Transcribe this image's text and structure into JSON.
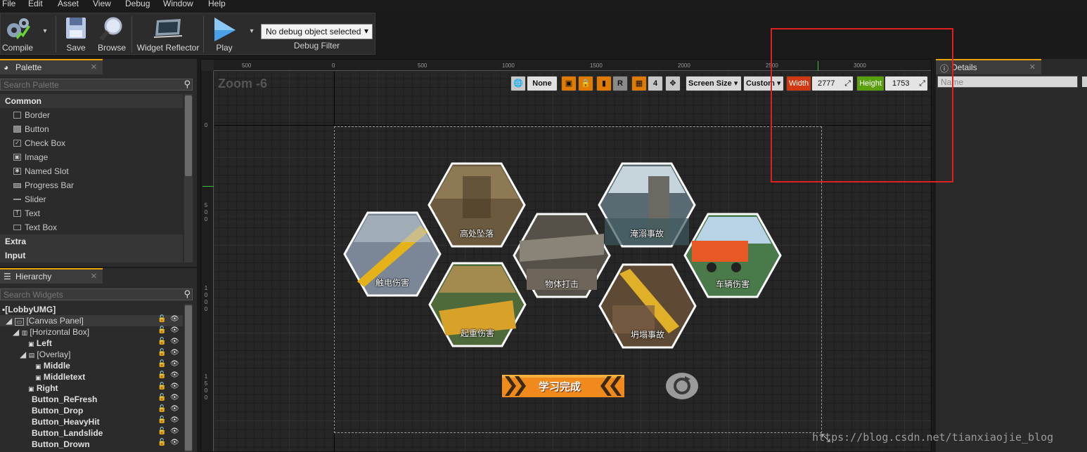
{
  "menu": [
    "File",
    "Edit",
    "Asset",
    "View",
    "Debug",
    "Window",
    "Help"
  ],
  "toolbar": {
    "compile": "Compile",
    "save": "Save",
    "browse": "Browse",
    "widget_reflector": "Widget Reflector",
    "play": "Play",
    "debug_object": "No debug object selected",
    "debug_filter": "Debug Filter"
  },
  "palette": {
    "tab": "Palette",
    "search_placeholder": "Search Palette",
    "categories": {
      "common": "Common",
      "extra": "Extra",
      "input": "Input"
    },
    "items": [
      "Border",
      "Button",
      "Check Box",
      "Image",
      "Named Slot",
      "Progress Bar",
      "Slider",
      "Text",
      "Text Box"
    ]
  },
  "hierarchy": {
    "tab": "Hierarchy",
    "search_placeholder": "Search Widgets",
    "root": "[LobbyUMG]",
    "rows": [
      "[Canvas Panel]",
      "[Horizontal Box]",
      "Left",
      "[Overlay]",
      "Middle",
      "Middletext",
      "Right",
      "Button_ReFresh",
      "Button_Drop",
      "Button_HeavyHit",
      "Button_Landslide",
      "Button_Drown"
    ]
  },
  "viewport": {
    "zoom": "Zoom -6",
    "ruler_top": [
      "500",
      "0",
      "500",
      "1000",
      "1500",
      "2000",
      "2500",
      "3000"
    ],
    "ruler_left": [
      [
        "0"
      ],
      [
        "5",
        "0",
        "0"
      ],
      [
        "1",
        "0",
        "0",
        "0"
      ],
      [
        "1",
        "5",
        "0",
        "0"
      ]
    ],
    "dpi_option": "None",
    "r_label": "R",
    "grid_count": "4",
    "screen_size": "Screen Size",
    "custom": "Custom",
    "width_label": "Width",
    "width_value": "2777",
    "height_label": "Height",
    "height_value": "1753",
    "hexes": [
      "高处坠落",
      "触电伤害",
      "物体打击",
      "起重伤害",
      "淹溺事故",
      "车辆伤害",
      "坍塌事故"
    ],
    "finish_button": "学习完成"
  },
  "details": {
    "tab": "Details",
    "name_placeholder": "Name"
  },
  "watermark": "https://blog.csdn.net/tianxiaojie_blog"
}
